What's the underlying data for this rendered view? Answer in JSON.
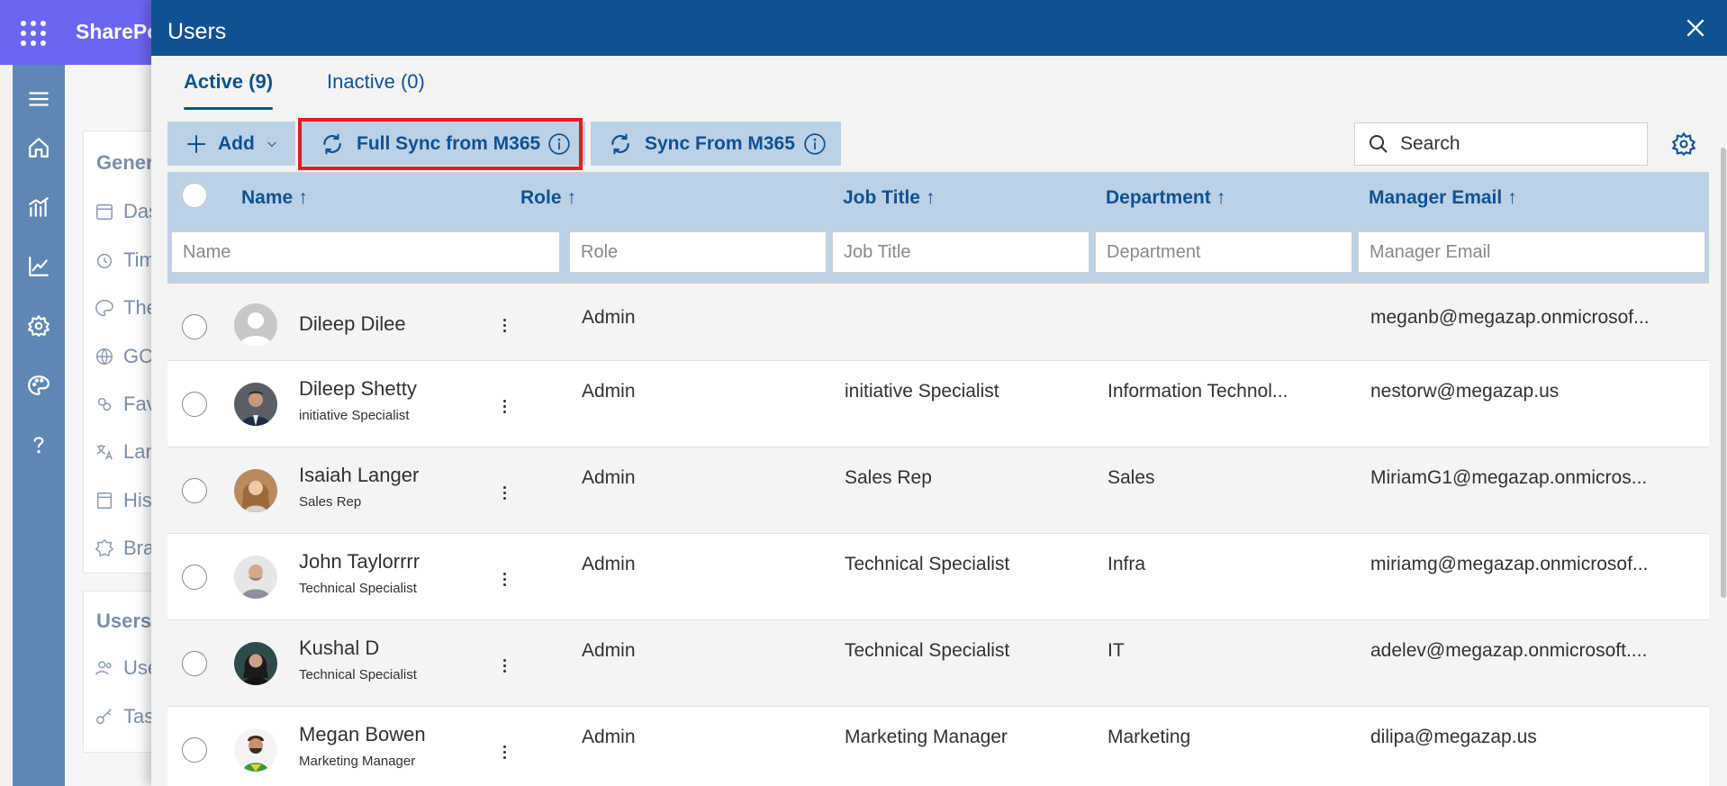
{
  "app": {
    "brand": "SharePoint"
  },
  "background_menu": {
    "section1_heading": "General",
    "items1": [
      "Dashboard",
      "Timing",
      "Theme",
      "GCC",
      "Favorites",
      "Language",
      "History",
      "Branding"
    ],
    "section2_heading": "Users",
    "items2": [
      "Users",
      "Tasks"
    ]
  },
  "panel": {
    "title": "Users",
    "tabs": [
      {
        "label": "Active (9)",
        "active": true
      },
      {
        "label": "Inactive (0)",
        "active": false
      }
    ],
    "commands": {
      "add_label": "Add",
      "full_sync_label": "Full Sync from M365",
      "sync_label": "Sync From M365"
    },
    "search": {
      "placeholder": "Search"
    },
    "columns": [
      {
        "label": "Name",
        "arrow": "↑",
        "filter_placeholder": "Name"
      },
      {
        "label": "Role",
        "arrow": "↑",
        "filter_placeholder": "Role"
      },
      {
        "label": "Job Title",
        "arrow": "↑",
        "filter_placeholder": "Job Title"
      },
      {
        "label": "Department",
        "arrow": "↑",
        "filter_placeholder": "Department"
      },
      {
        "label": "Manager Email",
        "arrow": "↑",
        "filter_placeholder": "Manager Email"
      }
    ],
    "rows": [
      {
        "name": "Dileep Dilee",
        "subtitle": "",
        "role": "Admin",
        "job_title": "",
        "department": "",
        "manager_email": "meganb@megazap.onmicrosof...",
        "avatar": "default"
      },
      {
        "name": "Dileep Shetty",
        "subtitle": "initiative Specialist",
        "role": "Admin",
        "job_title": "initiative Specialist",
        "department": "Information Technol...",
        "manager_email": "nestorw@megazap.us",
        "avatar": "photo"
      },
      {
        "name": "Isaiah Langer",
        "subtitle": "Sales Rep",
        "role": "Admin",
        "job_title": "Sales Rep",
        "department": "Sales",
        "manager_email": "MiriamG1@megazap.onmicros...",
        "avatar": "photo"
      },
      {
        "name": "John Taylorrrr",
        "subtitle": "Technical Specialist",
        "role": "Admin",
        "job_title": "Technical Specialist",
        "department": "Infra",
        "manager_email": "miriamg@megazap.onmicrosof...",
        "avatar": "photo"
      },
      {
        "name": "Kushal D",
        "subtitle": "Technical Specialist",
        "role": "Admin",
        "job_title": "Technical Specialist",
        "department": "IT",
        "manager_email": "adelev@megazap.onmicrosoft....",
        "avatar": "photo"
      },
      {
        "name": "Megan Bowen",
        "subtitle": "Marketing Manager",
        "role": "Admin",
        "job_title": "Marketing Manager",
        "department": "Marketing",
        "manager_email": "dilipa@megazap.us",
        "avatar": "photo"
      }
    ]
  },
  "colors": {
    "header_blue": "#0f5292",
    "command_bg": "#bcd1e6",
    "suite_bar": "#6b66f2",
    "rail": "#5f87b3",
    "highlight_red": "#e31b23"
  }
}
